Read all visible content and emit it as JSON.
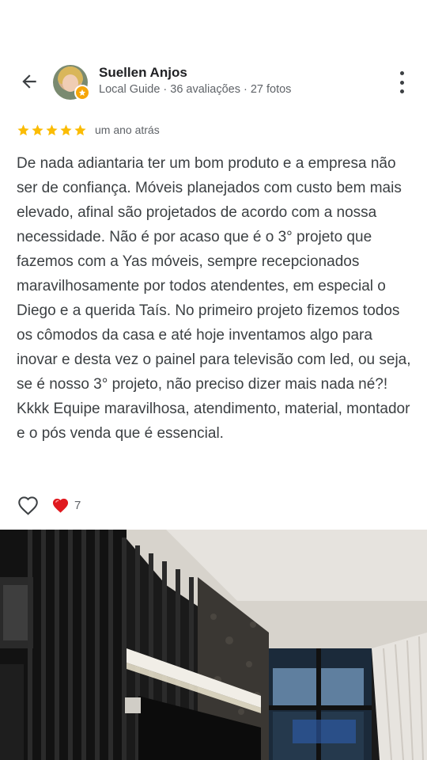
{
  "review_header": {
    "author_name": "Suellen Anjos",
    "author_meta": "Local Guide · 36 avaliações · 27 fotos",
    "back_icon": "arrow-back-icon",
    "more_icon": "more-vertical-icon",
    "badge_icon": "local-guide-star-badge-icon"
  },
  "rating": {
    "stars": 5,
    "star_color": "#fbbc04",
    "time_ago": "um ano atrás"
  },
  "review_text": "De nada adiantaria ter um bom produto e a empresa não ser de confiança. Móveis planejados com custo bem mais elevado, afinal são projetados de acordo com a nossa necessidade. Não é por acaso que é o 3° projeto que fazemos com a Yas móveis, sempre recepcionados maravilhosamente por todos atendentes, em especial o Diego e a querida Taís. No primeiro projeto fizemos todos os cômodos da casa e até hoje inventamos algo para inovar e desta vez o painel para televisão com led, ou seja, se é nosso 3° projeto, não preciso dizer mais nada né?! Kkkk Equipe maravilhosa, atendimento, material, montador e o pós venda que é essencial.",
  "reactions": {
    "like_icon": "heart-outline-icon",
    "reaction_icon": "red-heart-icon",
    "count": "7"
  },
  "photo": {
    "description_icon": "review-photo"
  }
}
